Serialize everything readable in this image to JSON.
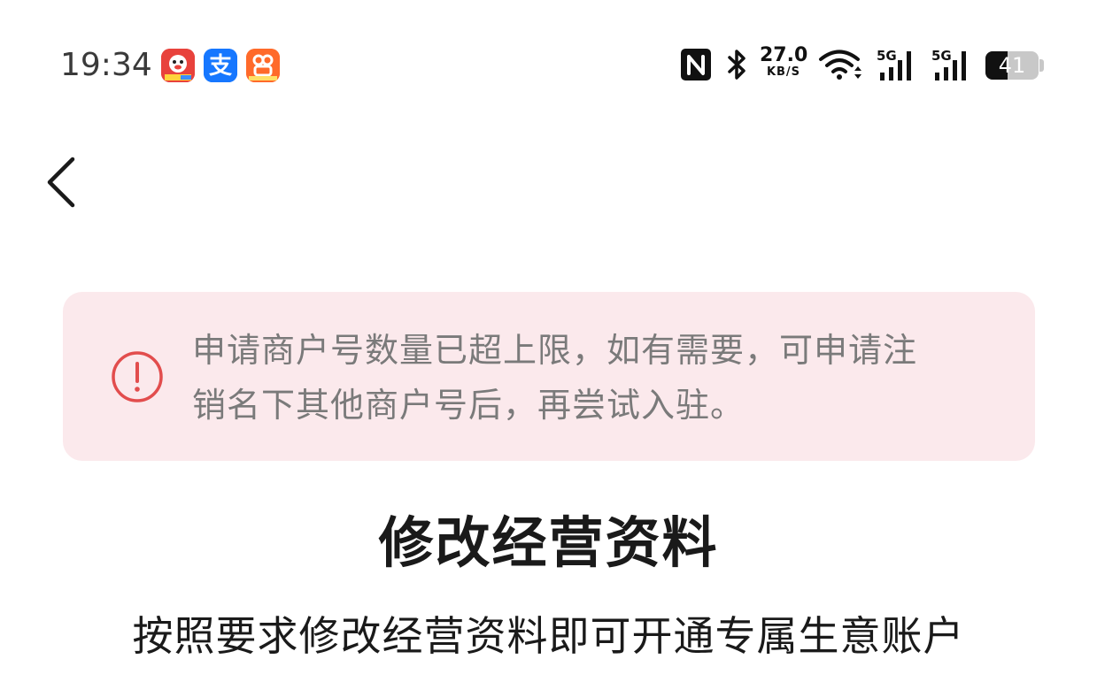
{
  "status_bar": {
    "time": "19:34",
    "net_speed_value": "27.0",
    "net_speed_unit": "KB/S",
    "signal_1_label": "5G",
    "signal_2_label": "5G",
    "battery_percent": "41",
    "battery_level": 0.41,
    "app_icons": [
      "jd-app-icon",
      "alipay-app-icon",
      "kuaishou-app-icon"
    ],
    "system_icons": [
      "nfc-icon",
      "bluetooth-icon",
      "wifi-icon",
      "signal-icon",
      "signal-icon",
      "battery-icon"
    ]
  },
  "nav": {
    "back_icon": "chevron-left-icon"
  },
  "warning": {
    "icon": "exclamation-circle-icon",
    "line1": "申请商户号数量已超上限，如有需要，可申请注",
    "line2": "销名下其他商户号后，再尝试入驻。",
    "background_color": "#fbe9ec",
    "icon_color": "#e24d4d"
  },
  "main": {
    "title": "修改经营资料",
    "subtitle": "按照要求修改经营资料即可开通专属生意账户"
  }
}
